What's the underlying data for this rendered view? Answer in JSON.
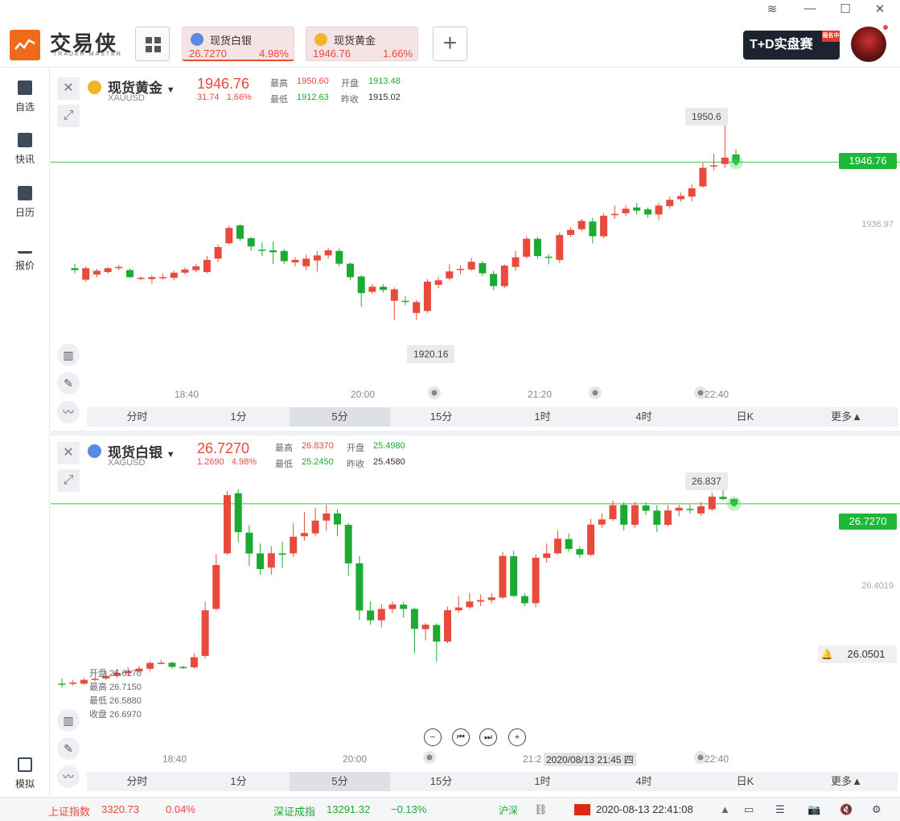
{
  "app": {
    "brand": "交易侠",
    "brand_sub": "TRADER MASTER"
  },
  "tabs": [
    {
      "name": "现货白银",
      "price": "26.7270",
      "pct": "4.98%"
    },
    {
      "name": "现货黄金",
      "price": "1946.76",
      "pct": "1.66%"
    }
  ],
  "banner": {
    "text": "T+D实盘赛",
    "tag": "报名中"
  },
  "sidebar": [
    {
      "label": "自选",
      "icon": "bookmark-icon"
    },
    {
      "label": "快讯",
      "icon": "news-icon"
    },
    {
      "label": "日历",
      "icon": "calendar-icon"
    },
    {
      "label": "报价",
      "icon": "quote-chart-icon"
    },
    {
      "label": "模拟",
      "icon": "wallet-icon"
    }
  ],
  "gold": {
    "name": "现货黄金",
    "code": "XAUUSD",
    "price": "1946.76",
    "change": "31.74",
    "pct": "1.66%",
    "high_label": "最高",
    "high": "1950.60",
    "open_label": "开盘",
    "open": "1913.48",
    "low_label": "最低",
    "low": "1912.63",
    "prev_label": "昨收",
    "prev": "1915.02",
    "max_tip": "1950.6",
    "min_tip": "1920.16",
    "right_price": "1946.76",
    "axis_mid": "1936.97",
    "times": [
      "18:40",
      "20:00",
      "21:20",
      "22:40"
    ]
  },
  "silver": {
    "name": "现货白银",
    "code": "XAGUSD",
    "price": "26.7270",
    "change": "1.2690",
    "pct": "4.98%",
    "high_label": "最高",
    "high": "26.8370",
    "open_label": "开盘",
    "open": "25.4980",
    "low_label": "最低",
    "low": "25.2450",
    "prev_label": "昨收",
    "prev": "25.4580",
    "max_tip": "26.837",
    "right_price": "26.7270",
    "axis_mid": "26.4019",
    "alert_price": "26.0501",
    "ohlc_open": "开盘 26.6170",
    "ohlc_high": "最高 26.7150",
    "ohlc_low": "最低 26.5880",
    "ohlc_close": "收盘 26.6970",
    "times": [
      "18:40",
      "20:00",
      "21:2",
      "22:40"
    ],
    "crosshair_time": "2020/08/13 21:45 四"
  },
  "periods": [
    "分时",
    "1分",
    "5分",
    "15分",
    "1时",
    "4时",
    "日K",
    "更多▲"
  ],
  "active_period": "5分",
  "footer": {
    "sh_label": "上证指数",
    "sh_value": "3320.73",
    "sh_pct": "0.04%",
    "sz_label": "深证成指",
    "sz_value": "13291.32",
    "sz_pct": "−0.13%",
    "hk_label": "沪深",
    "datetime": "2020-08-13 22:41:08"
  },
  "colors": {
    "up": "#e84a3c",
    "down": "#1daa33",
    "accent": "#f06a1c"
  },
  "chart_data": [
    {
      "type": "candlestick",
      "title": "现货黄金 XAUUSD",
      "interval": "5分",
      "ylim": [
        1918,
        1952
      ],
      "candles": [
        {
          "o": 1928.3,
          "c": 1928.0,
          "h": 1929.0,
          "l": 1927.5
        },
        {
          "o": 1926.5,
          "c": 1928.3,
          "h": 1928.6,
          "l": 1926.2
        },
        {
          "o": 1927.3,
          "c": 1927.9,
          "h": 1928.2,
          "l": 1926.9
        },
        {
          "o": 1927.7,
          "c": 1928.3,
          "h": 1928.5,
          "l": 1927.4
        },
        {
          "o": 1928.3,
          "c": 1928.5,
          "h": 1928.8,
          "l": 1928.0
        },
        {
          "o": 1928.0,
          "c": 1926.9,
          "h": 1928.2,
          "l": 1926.8
        },
        {
          "o": 1926.7,
          "c": 1926.8,
          "h": 1927.0,
          "l": 1926.4
        },
        {
          "o": 1926.6,
          "c": 1926.9,
          "h": 1927.2,
          "l": 1925.9
        },
        {
          "o": 1926.8,
          "c": 1926.9,
          "h": 1927.4,
          "l": 1926.5
        },
        {
          "o": 1926.8,
          "c": 1927.6,
          "h": 1927.9,
          "l": 1926.4
        },
        {
          "o": 1927.6,
          "c": 1928.1,
          "h": 1928.4,
          "l": 1927.3
        },
        {
          "o": 1928.0,
          "c": 1928.6,
          "h": 1929.0,
          "l": 1927.7
        },
        {
          "o": 1927.7,
          "c": 1929.6,
          "h": 1930.2,
          "l": 1927.5
        },
        {
          "o": 1929.8,
          "c": 1931.6,
          "h": 1932.0,
          "l": 1929.3
        },
        {
          "o": 1932.2,
          "c": 1934.6,
          "h": 1935.0,
          "l": 1932.0
        },
        {
          "o": 1935.0,
          "c": 1932.9,
          "h": 1935.2,
          "l": 1932.6
        },
        {
          "o": 1933.0,
          "c": 1931.7,
          "h": 1933.2,
          "l": 1931.0
        },
        {
          "o": 1931.2,
          "c": 1931.1,
          "h": 1932.3,
          "l": 1930.2
        },
        {
          "o": 1931.1,
          "c": 1930.8,
          "h": 1932.5,
          "l": 1929.0
        },
        {
          "o": 1931.0,
          "c": 1929.4,
          "h": 1931.3,
          "l": 1929.0
        },
        {
          "o": 1929.2,
          "c": 1929.6,
          "h": 1930.0,
          "l": 1928.6
        },
        {
          "o": 1928.6,
          "c": 1929.8,
          "h": 1930.4,
          "l": 1928.0
        },
        {
          "o": 1929.5,
          "c": 1930.3,
          "h": 1931.0,
          "l": 1927.8
        },
        {
          "o": 1930.3,
          "c": 1931.1,
          "h": 1931.5,
          "l": 1929.8
        },
        {
          "o": 1931.0,
          "c": 1929.0,
          "h": 1931.4,
          "l": 1928.6
        },
        {
          "o": 1929.0,
          "c": 1926.9,
          "h": 1929.2,
          "l": 1926.5
        },
        {
          "o": 1927.0,
          "c": 1924.4,
          "h": 1927.2,
          "l": 1922.3
        },
        {
          "o": 1924.6,
          "c": 1925.4,
          "h": 1925.8,
          "l": 1924.3
        },
        {
          "o": 1925.4,
          "c": 1924.9,
          "h": 1925.8,
          "l": 1924.5
        },
        {
          "o": 1923.2,
          "c": 1925.0,
          "h": 1925.3,
          "l": 1920.2
        },
        {
          "o": 1923.2,
          "c": 1923.1,
          "h": 1923.9,
          "l": 1922.5
        },
        {
          "o": 1921.3,
          "c": 1923.0,
          "h": 1923.3,
          "l": 1920.2
        },
        {
          "o": 1921.6,
          "c": 1926.2,
          "h": 1926.6,
          "l": 1921.3
        },
        {
          "o": 1925.7,
          "c": 1926.4,
          "h": 1926.9,
          "l": 1925.2
        },
        {
          "o": 1926.7,
          "c": 1927.8,
          "h": 1928.9,
          "l": 1926.4
        },
        {
          "o": 1928.1,
          "c": 1928.2,
          "h": 1928.7,
          "l": 1927.4
        },
        {
          "o": 1928.1,
          "c": 1929.3,
          "h": 1929.9,
          "l": 1927.9
        },
        {
          "o": 1929.1,
          "c": 1927.5,
          "h": 1929.4,
          "l": 1927.1
        },
        {
          "o": 1927.4,
          "c": 1925.5,
          "h": 1927.9,
          "l": 1924.9
        },
        {
          "o": 1925.5,
          "c": 1928.7,
          "h": 1928.9,
          "l": 1925.2
        },
        {
          "o": 1928.5,
          "c": 1930.0,
          "h": 1931.0,
          "l": 1927.9
        },
        {
          "o": 1930.1,
          "c": 1932.9,
          "h": 1933.3,
          "l": 1929.8
        },
        {
          "o": 1932.9,
          "c": 1930.2,
          "h": 1933.2,
          "l": 1929.8
        },
        {
          "o": 1930.1,
          "c": 1930.0,
          "h": 1930.5,
          "l": 1928.9
        },
        {
          "o": 1929.6,
          "c": 1933.5,
          "h": 1933.9,
          "l": 1929.1
        },
        {
          "o": 1933.5,
          "c": 1934.3,
          "h": 1934.7,
          "l": 1933.2
        },
        {
          "o": 1934.4,
          "c": 1935.7,
          "h": 1936.0,
          "l": 1934.1
        },
        {
          "o": 1935.6,
          "c": 1933.3,
          "h": 1936.2,
          "l": 1932.2
        },
        {
          "o": 1933.3,
          "c": 1936.5,
          "h": 1936.9,
          "l": 1933.0
        },
        {
          "o": 1936.6,
          "c": 1936.8,
          "h": 1938.1,
          "l": 1936.0
        },
        {
          "o": 1936.9,
          "c": 1937.6,
          "h": 1938.1,
          "l": 1936.5
        },
        {
          "o": 1937.8,
          "c": 1937.3,
          "h": 1938.5,
          "l": 1936.7
        },
        {
          "o": 1937.5,
          "c": 1936.7,
          "h": 1937.8,
          "l": 1936.2
        },
        {
          "o": 1936.7,
          "c": 1938.1,
          "h": 1938.5,
          "l": 1935.9
        },
        {
          "o": 1938.0,
          "c": 1939.0,
          "h": 1939.5,
          "l": 1937.6
        },
        {
          "o": 1939.1,
          "c": 1939.6,
          "h": 1940.1,
          "l": 1938.7
        },
        {
          "o": 1939.5,
          "c": 1940.8,
          "h": 1941.4,
          "l": 1938.8
        },
        {
          "o": 1941.1,
          "c": 1944.0,
          "h": 1944.8,
          "l": 1940.9
        },
        {
          "o": 1944.3,
          "c": 1944.4,
          "h": 1946.2,
          "l": 1943.6
        },
        {
          "o": 1944.6,
          "c": 1945.6,
          "h": 1950.6,
          "l": 1944.0
        },
        {
          "o": 1946.1,
          "c": 1944.9,
          "h": 1946.9,
          "l": 1944.3
        }
      ]
    },
    {
      "type": "candlestick",
      "title": "现货白银 XAGUSD",
      "interval": "5分",
      "ylim": [
        25.25,
        26.9
      ],
      "candles": [
        {
          "o": 25.486,
          "c": 25.483,
          "h": 25.521,
          "l": 25.46
        },
        {
          "o": 25.484,
          "c": 25.493,
          "h": 25.512,
          "l": 25.471
        },
        {
          "o": 25.485,
          "c": 25.512,
          "h": 25.525,
          "l": 25.479
        },
        {
          "o": 25.515,
          "c": 25.52,
          "h": 25.534,
          "l": 25.502
        },
        {
          "o": 25.522,
          "c": 25.54,
          "h": 25.571,
          "l": 25.51
        },
        {
          "o": 25.54,
          "c": 25.561,
          "h": 25.589,
          "l": 25.526
        },
        {
          "o": 25.559,
          "c": 25.574,
          "h": 25.6,
          "l": 25.542
        },
        {
          "o": 25.572,
          "c": 25.591,
          "h": 25.61,
          "l": 25.559
        },
        {
          "o": 25.59,
          "c": 25.631,
          "h": 25.642,
          "l": 25.571
        },
        {
          "o": 25.63,
          "c": 25.632,
          "h": 25.65,
          "l": 25.621
        },
        {
          "o": 25.632,
          "c": 25.603,
          "h": 25.641,
          "l": 25.59
        },
        {
          "o": 25.602,
          "c": 25.599,
          "h": 25.612,
          "l": 25.59
        },
        {
          "o": 25.6,
          "c": 25.671,
          "h": 25.7,
          "l": 25.59
        },
        {
          "o": 25.68,
          "c": 26.0,
          "h": 26.06,
          "l": 25.661
        },
        {
          "o": 26.01,
          "c": 26.318,
          "h": 26.395,
          "l": 25.998
        },
        {
          "o": 26.4,
          "c": 26.809,
          "h": 26.837,
          "l": 26.392
        },
        {
          "o": 26.822,
          "c": 26.549,
          "h": 26.85,
          "l": 26.48
        },
        {
          "o": 26.545,
          "c": 26.399,
          "h": 26.6,
          "l": 26.313
        },
        {
          "o": 26.4,
          "c": 26.29,
          "h": 26.47,
          "l": 26.251
        },
        {
          "o": 26.3,
          "c": 26.401,
          "h": 26.45,
          "l": 26.251
        },
        {
          "o": 26.4,
          "c": 26.39,
          "h": 26.48,
          "l": 26.298
        },
        {
          "o": 26.4,
          "c": 26.517,
          "h": 26.61,
          "l": 26.372
        },
        {
          "o": 26.52,
          "c": 26.543,
          "h": 26.689,
          "l": 26.49
        },
        {
          "o": 26.54,
          "c": 26.63,
          "h": 26.72,
          "l": 26.521
        },
        {
          "o": 26.63,
          "c": 26.68,
          "h": 26.74,
          "l": 26.56
        },
        {
          "o": 26.68,
          "c": 26.603,
          "h": 26.71,
          "l": 26.52
        },
        {
          "o": 26.6,
          "c": 26.33,
          "h": 26.612,
          "l": 26.242
        },
        {
          "o": 26.33,
          "c": 25.999,
          "h": 26.38,
          "l": 25.93
        },
        {
          "o": 25.999,
          "c": 25.93,
          "h": 26.062,
          "l": 25.899
        },
        {
          "o": 25.93,
          "c": 26.01,
          "h": 26.043,
          "l": 25.88
        },
        {
          "o": 26.009,
          "c": 26.041,
          "h": 26.061,
          "l": 25.981
        },
        {
          "o": 26.04,
          "c": 26.01,
          "h": 26.06,
          "l": 25.95
        },
        {
          "o": 26.01,
          "c": 25.87,
          "h": 26.02,
          "l": 25.7
        },
        {
          "o": 25.868,
          "c": 25.899,
          "h": 25.912,
          "l": 25.789
        },
        {
          "o": 25.897,
          "c": 25.781,
          "h": 25.91,
          "l": 25.64
        },
        {
          "o": 25.781,
          "c": 26.001,
          "h": 26.025,
          "l": 25.77
        },
        {
          "o": 26.0,
          "c": 26.02,
          "h": 26.101,
          "l": 25.982
        },
        {
          "o": 26.022,
          "c": 26.062,
          "h": 26.122,
          "l": 26.011
        },
        {
          "o": 26.061,
          "c": 26.072,
          "h": 26.112,
          "l": 26.031
        },
        {
          "o": 26.072,
          "c": 26.091,
          "h": 26.118,
          "l": 26.052
        },
        {
          "o": 26.09,
          "c": 26.382,
          "h": 26.41,
          "l": 26.079
        },
        {
          "o": 26.38,
          "c": 26.101,
          "h": 26.418,
          "l": 26.09
        },
        {
          "o": 26.1,
          "c": 26.05,
          "h": 26.122,
          "l": 26.03
        },
        {
          "o": 26.05,
          "c": 26.369,
          "h": 26.391,
          "l": 26.022
        },
        {
          "o": 26.368,
          "c": 26.4,
          "h": 26.47,
          "l": 26.334
        },
        {
          "o": 26.4,
          "c": 26.503,
          "h": 26.56,
          "l": 26.39
        },
        {
          "o": 26.5,
          "c": 26.431,
          "h": 26.54,
          "l": 26.411
        },
        {
          "o": 26.43,
          "c": 26.391,
          "h": 26.45,
          "l": 26.369
        },
        {
          "o": 26.39,
          "c": 26.602,
          "h": 26.64,
          "l": 26.381
        },
        {
          "o": 26.602,
          "c": 26.638,
          "h": 26.681,
          "l": 26.579
        },
        {
          "o": 26.64,
          "c": 26.738,
          "h": 26.771,
          "l": 26.629
        },
        {
          "o": 26.74,
          "c": 26.601,
          "h": 26.76,
          "l": 26.561
        },
        {
          "o": 26.6,
          "c": 26.738,
          "h": 26.761,
          "l": 26.579
        },
        {
          "o": 26.736,
          "c": 26.699,
          "h": 26.757,
          "l": 26.669
        },
        {
          "o": 26.7,
          "c": 26.601,
          "h": 26.738,
          "l": 26.549
        },
        {
          "o": 26.6,
          "c": 26.701,
          "h": 26.738,
          "l": 26.589
        },
        {
          "o": 26.7,
          "c": 26.72,
          "h": 26.74,
          "l": 26.66
        },
        {
          "o": 26.712,
          "c": 26.705,
          "h": 26.74,
          "l": 26.68
        },
        {
          "o": 26.68,
          "c": 26.73,
          "h": 26.76,
          "l": 26.662
        },
        {
          "o": 26.71,
          "c": 26.798,
          "h": 26.823,
          "l": 26.698
        },
        {
          "o": 26.797,
          "c": 26.781,
          "h": 26.844,
          "l": 26.772
        },
        {
          "o": 26.781,
          "c": 26.748,
          "h": 26.788,
          "l": 26.738
        }
      ]
    }
  ]
}
